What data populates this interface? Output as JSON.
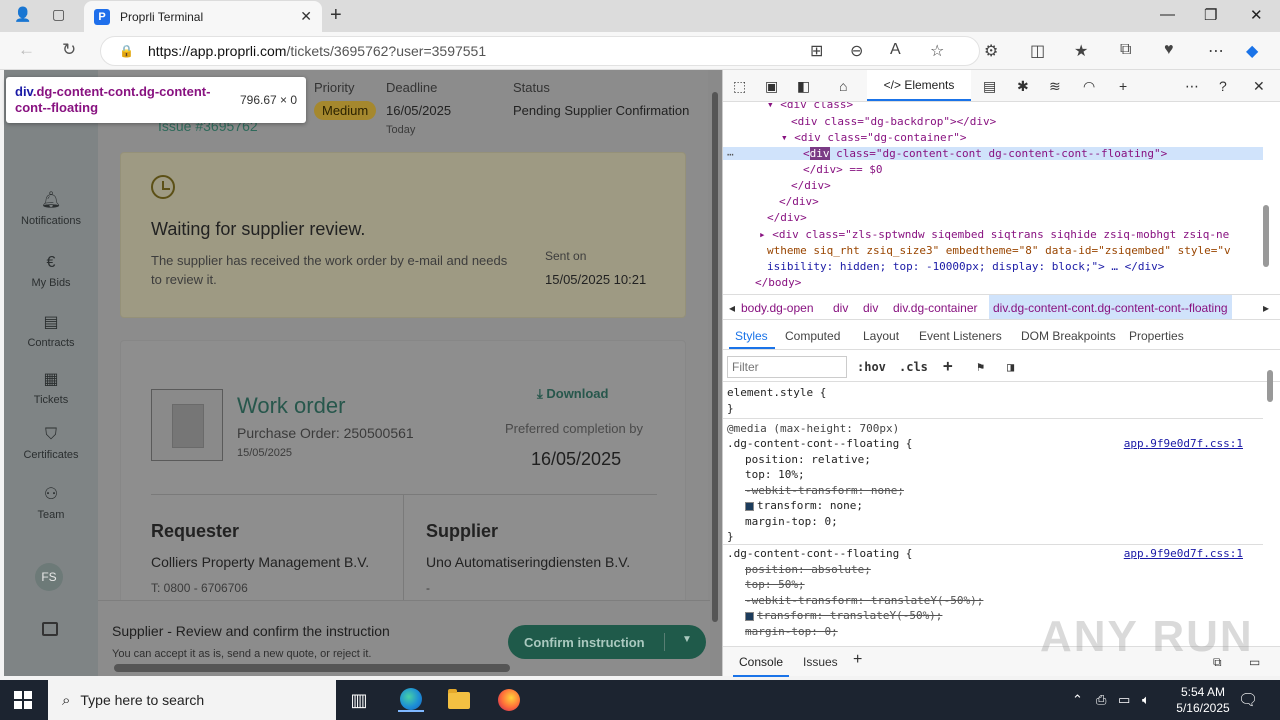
{
  "browser": {
    "tab_title": "Proprli Terminal",
    "tab_favicon": "P",
    "url_host": "https://app.proprli.com",
    "url_path": "/tickets/3695762?user=3597551"
  },
  "tooltip": {
    "selector_tag": "div",
    "selector_classes": ".dg-content-cont.dg-content-cont--floating",
    "size": "796.67 × 0"
  },
  "sidebar": {
    "items": [
      {
        "label": "Notifications",
        "icon": "bell-icon"
      },
      {
        "label": "My Bids",
        "icon": "euro-icon"
      },
      {
        "label": "Contracts",
        "icon": "document-icon"
      },
      {
        "label": "Tickets",
        "icon": "clipboard-icon"
      },
      {
        "label": "Certificates",
        "icon": "shield-check-icon"
      },
      {
        "label": "Team",
        "icon": "team-icon"
      }
    ],
    "avatar_initials": "FS"
  },
  "ticket": {
    "issue_number": "Issue #3695762",
    "priority_label": "Priority",
    "priority_value": "Medium",
    "deadline_label": "Deadline",
    "deadline_value": "16/05/2025",
    "deadline_sub": "Today",
    "status_label": "Status",
    "status_value": "Pending Supplier Confirmation"
  },
  "waiting_card": {
    "title": "Waiting for supplier review.",
    "description": "The supplier has received the work order by e-mail and needs to review it.",
    "sent_label": "Sent on",
    "sent_value": "15/05/2025 10:21"
  },
  "work_order": {
    "title": "Work order",
    "purchase_order": "Purchase Order: 250500561",
    "date": "15/05/2025",
    "download_label": "Download",
    "preferred_label": "Preferred completion by",
    "preferred_value": "16/05/2025",
    "requester_title": "Requester",
    "requester_name": "Colliers Property Management B.V.",
    "requester_phone": "T: 0800 - 6706706",
    "supplier_title": "Supplier",
    "supplier_name": "Uno Automatiseringdiensten B.V.",
    "supplier_phone": "-"
  },
  "bottom_bar": {
    "title": "Supplier - Review and confirm the instruction",
    "subtitle": "You can accept it as is, send a new quote, or reject it.",
    "confirm_label": "Confirm instruction"
  },
  "devtools": {
    "elements_tab": "Elements",
    "dom_lines": {
      "l1": "<div class>",
      "l2a": "<div class=\"dg-backdrop\"></div>",
      "l3": "<div class=\"dg-container\">",
      "l4_tag": "div",
      "l4_rest": " class=\"dg-content-cont dg-content-cont--floating\">",
      "l5": "</div> == $0",
      "l6": "</div>",
      "l7": "</div>",
      "l8": "</div>",
      "l9": "<div class=\"zls-sptwndw  siqembed siqtrans siqhide zsiq-mobhgt zsiq-ne",
      "l10": "wtheme siq_rht zsiq_size3\" embedtheme=\"8\" data-id=\"zsiqembed\" style=\"v",
      "l11": "isibility: hidden; top: -10000px; display: block;\"> … </div>",
      "l12": "</body>"
    },
    "breadcrumbs": [
      "body.dg-open",
      "div",
      "div",
      "div.dg-container",
      "div.dg-content-cont.dg-content-cont--floating"
    ],
    "subtabs": [
      "Styles",
      "Computed",
      "Layout",
      "Event Listeners",
      "DOM Breakpoints",
      "Properties"
    ],
    "filter_placeholder": "Filter",
    "filter_hov": ":hov",
    "filter_cls": ".cls",
    "styles": {
      "element_style": "element.style {",
      "close": "}",
      "media": "@media (max-height: 700px)",
      "rule1_selector": ".dg-content-cont--floating {",
      "rule1_source": "app.9f9e0d7f.css:1",
      "rule1_props": [
        {
          "text": "position: relative;",
          "struck": false
        },
        {
          "text": "top: 10%;",
          "struck": false
        },
        {
          "text": "-webkit-transform: none;",
          "struck": true
        },
        {
          "text": "transform: none;",
          "struck": false,
          "swatch": true
        },
        {
          "text": "margin-top: 0;",
          "struck": false
        }
      ],
      "rule2_selector": ".dg-content-cont--floating {",
      "rule2_source": "app.9f9e0d7f.css:1",
      "rule2_props": [
        {
          "text": "position: absolute;",
          "struck": true
        },
        {
          "text": "top: 50%;",
          "struck": true
        },
        {
          "text": "-webkit-transform: translateY(-50%);",
          "struck": true
        },
        {
          "text": "transform: translateY(-50%);",
          "struck": true,
          "swatch": true
        },
        {
          "text": "margin-top: 0;",
          "struck": true
        }
      ]
    },
    "drawer_tabs": [
      "Console",
      "Issues"
    ]
  },
  "watermark": "ANY RUN",
  "taskbar": {
    "search_placeholder": "Type here to search",
    "time": "5:54 AM",
    "date": "5/16/2025"
  }
}
